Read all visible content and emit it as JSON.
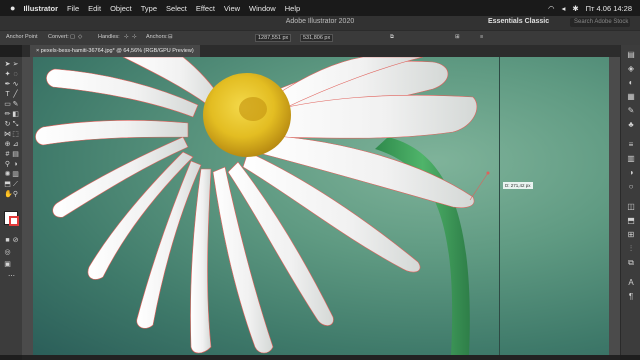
{
  "menubar": {
    "app": "Illustrator",
    "items": [
      "File",
      "Edit",
      "Object",
      "Type",
      "Select",
      "Effect",
      "View",
      "Window",
      "Help"
    ],
    "clock": "Пт 4.06  14:28"
  },
  "appbar": {
    "title": "Adobe Illustrator 2020",
    "workspace": "Essentials Classic",
    "search_placeholder": "Search Adobe Stock"
  },
  "control": {
    "anchor_point": "Anchor Point",
    "convert": "Convert:",
    "handles": "Handles:",
    "anchors": "Anchors:",
    "x_value": "1287,551 px",
    "y_value": "531,806 px"
  },
  "document": {
    "tab": "pexels-bess-hamiti-36764.jpg* @ 64,56% (RGB/GPU Preview)"
  },
  "canvas": {
    "tooltip": "D: 271,42 px"
  },
  "colors": {
    "accent_path": "#e0605a",
    "petal": "#f4f4f4",
    "center": "#e9c62a",
    "stem": "#3f9a5a"
  }
}
